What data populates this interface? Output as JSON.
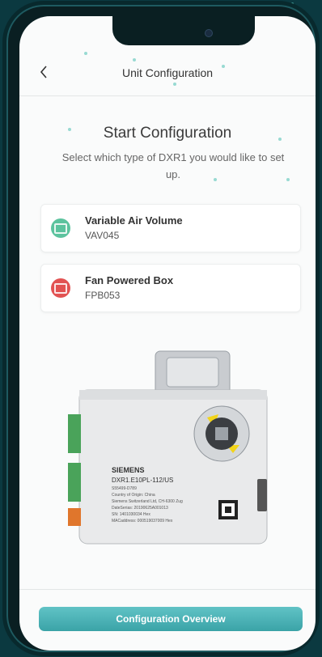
{
  "header": {
    "back_icon": "chevron-left-icon",
    "title": "Unit Configuration"
  },
  "intro": {
    "title": "Start Configuration",
    "subtitle": "Select which type of DXR1 you would like to set up."
  },
  "options": [
    {
      "title": "Variable Air Volume",
      "code": "VAV045",
      "icon": "unit-icon",
      "color": "#5cc39e"
    },
    {
      "title": "Fan Powered Box",
      "code": "FPB053",
      "icon": "unit-icon",
      "color": "#e25252"
    }
  ],
  "device": {
    "brand": "SIEMENS",
    "model": "DXR1.E10PL-112/US",
    "part": "S55499-D789",
    "origin": "Country of Origin: China",
    "company": "Siemens Switzerland Ltd, CH-6300 Zug",
    "serial1": "DateSerias: 20190625A001013",
    "serial2": "SN: 1401030034 Hex",
    "serial3": "MACaddress: 000519037009 Hex"
  },
  "footer": {
    "button_label": "Configuration Overview"
  },
  "colors": {
    "accent": "#4bb4b7",
    "background": "#0b3940"
  }
}
